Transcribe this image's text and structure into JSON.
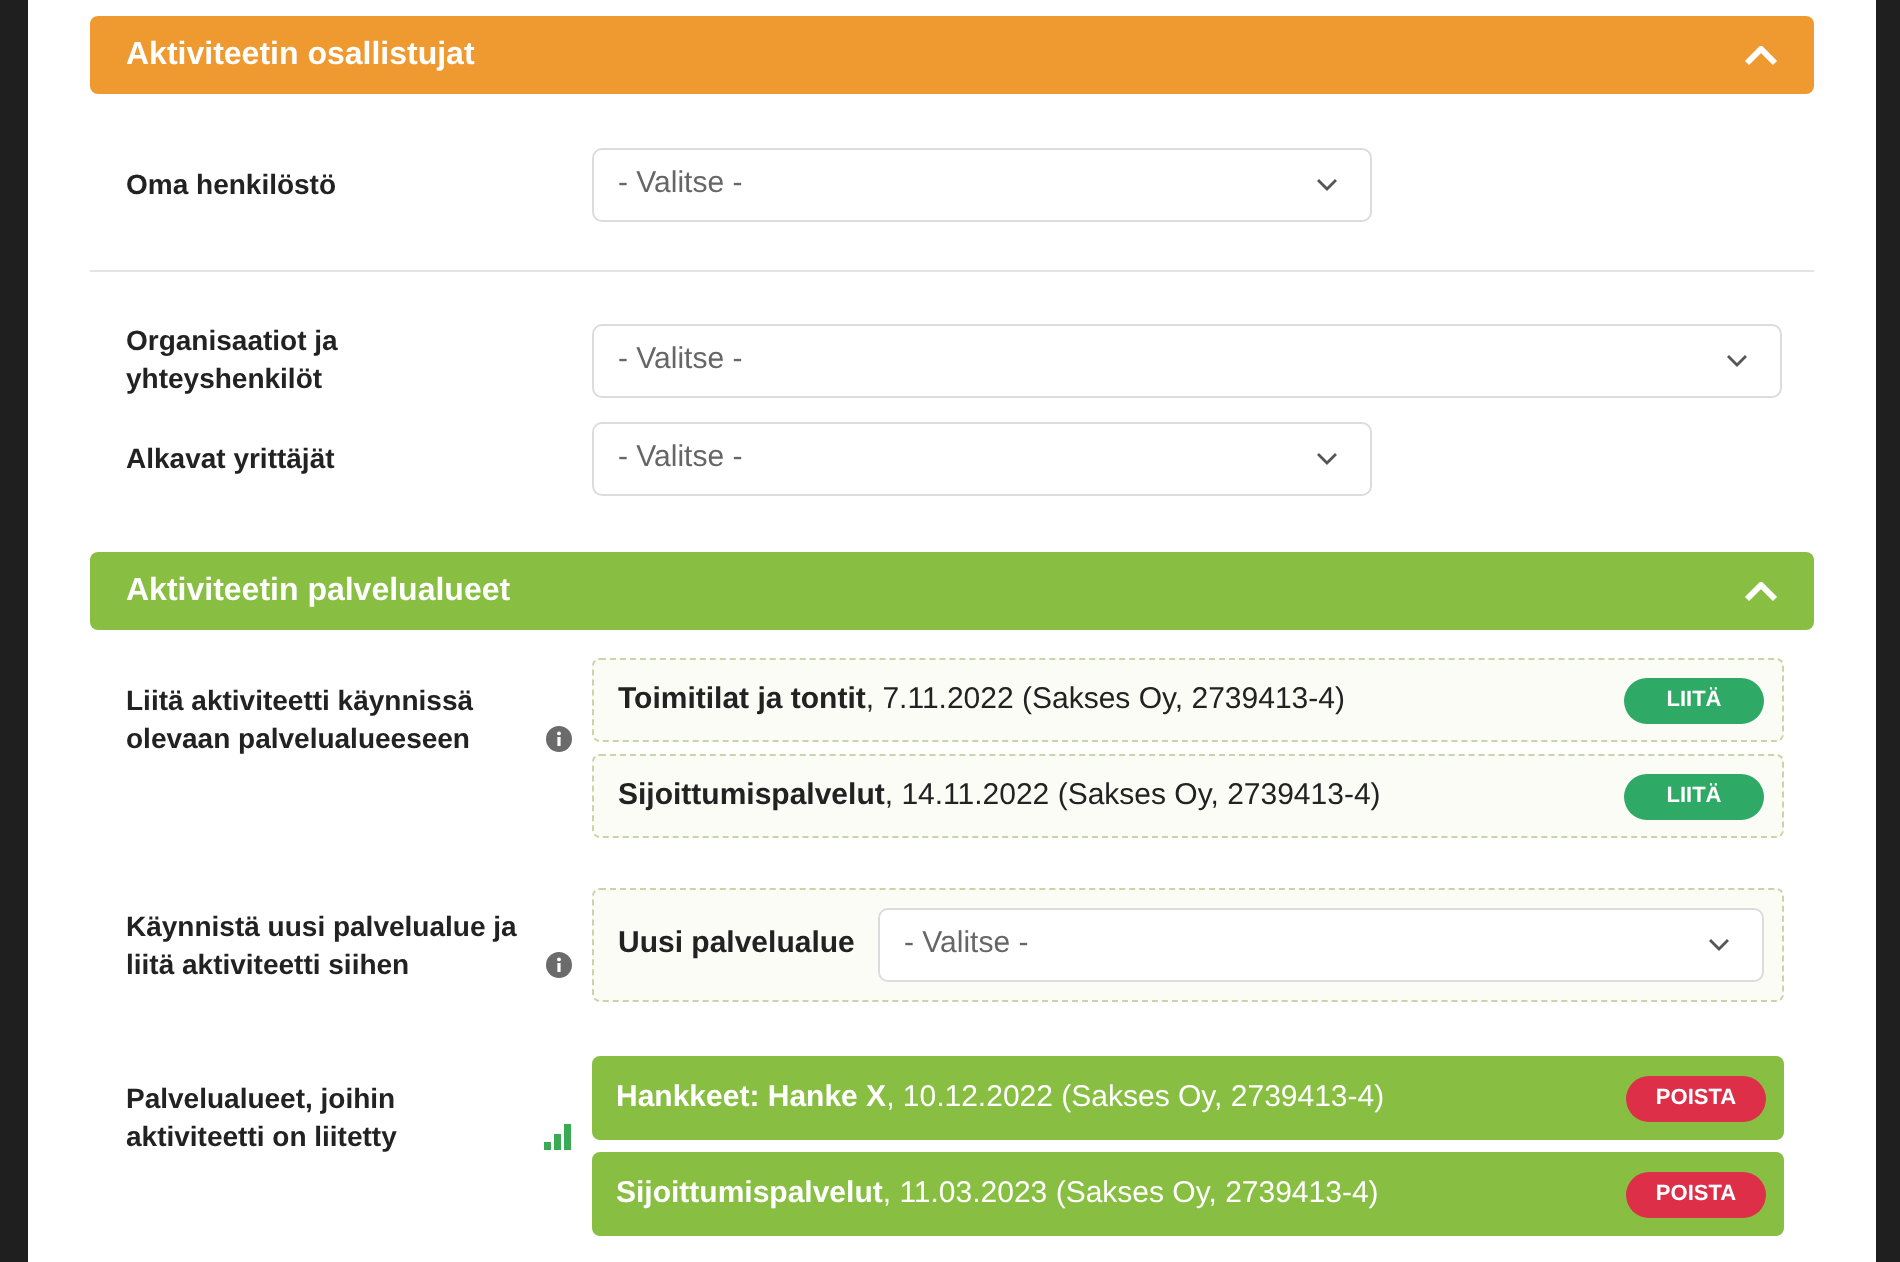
{
  "sections": [
    {
      "title": "Aktiviteetin osallistujat",
      "color": "#ee9a30",
      "expanded": true,
      "rows": [
        {
          "kind": "select",
          "label": "Oma henkilöstö",
          "placeholder": "- Valitse -",
          "wide": false,
          "divider_after": true
        },
        {
          "kind": "select",
          "label": "Organisaatiot ja yhteyshenkilöt",
          "placeholder": "- Valitse -",
          "wide": true
        },
        {
          "kind": "select",
          "label": "Alkavat yrittäjät",
          "placeholder": "- Valitse -",
          "wide": false
        }
      ]
    },
    {
      "title": "Aktiviteetin palvelualueet",
      "color": "#88bf42",
      "expanded": true,
      "rows": [
        {
          "kind": "attach",
          "label": "Liitä aktiviteetti käynnissä olevaan palvelualueeseen",
          "info": true,
          "items": [
            {
              "text": "**Toimitilat ja tontit**, 7.11.2022 (Sakses Oy, 2739413-4)",
              "button": "LIITÄ"
            },
            {
              "text": "**Sijoittumispalvelut**, 14.11.2022 (Sakses Oy, 2739413-4)",
              "button": "LIITÄ"
            }
          ]
        },
        {
          "kind": "new",
          "label": "Käynnistä uusi palvelualue ja liitä aktiviteetti siihen",
          "info": true,
          "field_label": "Uusi palvelualue",
          "placeholder": "- Valitse -"
        },
        {
          "kind": "linked",
          "label": "Palvelualueet, joihin aktiviteetti on liitetty",
          "stats": true,
          "items": [
            {
              "text": "**Hankkeet: Hanke X**, 10.12.2022 (Sakses Oy, 2739413-4)",
              "button": "POISTA"
            },
            {
              "text": "**Sijoittumispalvelut**, 11.03.2023 (Sakses Oy, 2739413-4)",
              "button": "POISTA"
            }
          ]
        }
      ]
    }
  ]
}
